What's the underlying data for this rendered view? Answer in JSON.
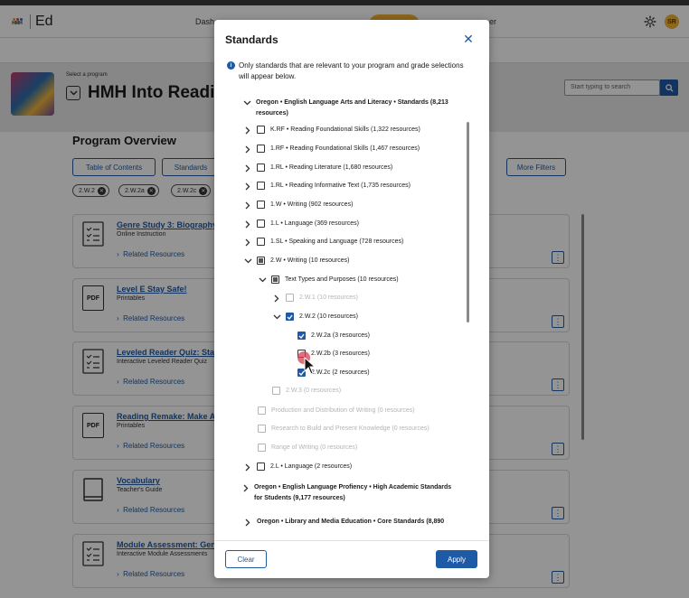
{
  "app": {
    "logo_mark": "HMH",
    "logo_text": "Ed",
    "nav_left": "Dash",
    "nav_right": "er",
    "avatar_initials": "SR",
    "colors": {
      "brand": "#1f5aa6",
      "accent": "#f2b133"
    }
  },
  "program": {
    "label": "Select a program",
    "title": "HMH Into Reading",
    "search_placeholder": "Start typing to search"
  },
  "overview": {
    "title": "Program Overview",
    "buttons": [
      "Table of Contents",
      "Standards",
      "More Filters"
    ],
    "chips": [
      "2.W.2",
      "2.W.2a",
      "2.W.2c"
    ]
  },
  "cards": [
    {
      "title": "Genre Study 3: Biography",
      "subtitle": "Online Instruction",
      "related": "Related Resources",
      "icon": "checklist-icon"
    },
    {
      "title": "Level E Stay Safe!",
      "subtitle": "Printables",
      "related": "Related Resources",
      "icon": "pdf-icon",
      "icon_text": "PDF"
    },
    {
      "title": "Leveled Reader Quiz: Sta",
      "subtitle": "Interactive Leveled Reader Quiz",
      "related": "Related Resources",
      "icon": "checklist-icon"
    },
    {
      "title": "Reading Remake: Make A",
      "subtitle": "Printables",
      "related": "Related Resources",
      "icon": "pdf-icon",
      "icon_text": "PDF"
    },
    {
      "title": "Vocabulary",
      "subtitle": "Teacher's Guide",
      "related": "Related Resources",
      "icon": "book-icon"
    },
    {
      "title": "Module Assessment: Genr",
      "subtitle": "Interactive Module Assessments",
      "related": "Related Resources",
      "icon": "checklist-icon"
    }
  ],
  "modal": {
    "title": "Standards",
    "info": "Only standards that are relevant to your program and grade selections will appear below.",
    "tree": [
      {
        "label": "Oregon • English Language Arts and Literacy • Standards (8,213 resources)",
        "depth": 0,
        "expander": "down",
        "checkbox": "none",
        "bold": true,
        "muted": false
      },
      {
        "label": "K.RF • Reading Foundational Skills (1,322 resources)",
        "depth": 1,
        "expander": "right",
        "checkbox": "empty",
        "bold": false,
        "muted": false
      },
      {
        "label": "1.RF • Reading Foundational Skills (1,467 resources)",
        "depth": 1,
        "expander": "right",
        "checkbox": "empty",
        "bold": false,
        "muted": false
      },
      {
        "label": "1.RL • Reading Literature (1,680 resources)",
        "depth": 1,
        "expander": "right",
        "checkbox": "empty",
        "bold": false,
        "muted": false
      },
      {
        "label": "1.RL • Reading Informative Text (1,735 resources)",
        "depth": 1,
        "expander": "right",
        "checkbox": "empty",
        "bold": false,
        "muted": false
      },
      {
        "label": "1.W • Writing (902 resources)",
        "depth": 1,
        "expander": "right",
        "checkbox": "empty",
        "bold": false,
        "muted": false
      },
      {
        "label": "1.L • Language (369 resources)",
        "depth": 1,
        "expander": "right",
        "checkbox": "empty",
        "bold": false,
        "muted": false
      },
      {
        "label": "1.SL • Speaking and Language (728 resources)",
        "depth": 1,
        "expander": "right",
        "checkbox": "empty",
        "bold": false,
        "muted": false
      },
      {
        "label": "2.W • Writing (10 resources)",
        "depth": 1,
        "expander": "down",
        "checkbox": "indeterminate",
        "bold": false,
        "muted": false
      },
      {
        "label": "Text Types and Purposes (10 resources)",
        "depth": 2,
        "expander": "down",
        "checkbox": "indeterminate",
        "bold": false,
        "muted": false
      },
      {
        "label": "2.W.1 (10 resources)",
        "depth": 3,
        "expander": "right",
        "checkbox": "empty",
        "bold": false,
        "muted": true
      },
      {
        "label": "2.W.2 (10 resources)",
        "depth": 3,
        "expander": "down",
        "checkbox": "checked",
        "bold": false,
        "muted": false
      },
      {
        "label": "2.W.2a (3 resources)",
        "depth": 4,
        "expander": "none",
        "checkbox": "checked",
        "bold": false,
        "muted": false
      },
      {
        "label": "2.W.2b (3 resources)",
        "depth": 4,
        "expander": "none",
        "checkbox": "empty",
        "bold": false,
        "muted": false
      },
      {
        "label": "2.W.2c (2 resources)",
        "depth": 4,
        "expander": "none",
        "checkbox": "checked",
        "bold": false,
        "muted": false
      },
      {
        "label": "2.W.3 (0 resources)",
        "depth": 3,
        "expander": "none",
        "checkbox": "empty",
        "bold": false,
        "muted": true
      },
      {
        "label": "Production and Distribution of Writing (0 resources)",
        "depth": 2,
        "expander": "none",
        "checkbox": "empty",
        "bold": false,
        "muted": true
      },
      {
        "label": "Research to Build and Present Knowledge (0 resources)",
        "depth": 2,
        "expander": "none",
        "checkbox": "empty",
        "bold": false,
        "muted": true
      },
      {
        "label": "Range of Writing (0 resources)",
        "depth": 2,
        "expander": "none",
        "checkbox": "empty",
        "bold": false,
        "muted": true
      },
      {
        "label": "2.L • Language (2 resources)",
        "depth": 1,
        "expander": "right",
        "checkbox": "empty",
        "bold": false,
        "muted": false
      },
      {
        "label": "Oregon • English Language Profiency • High Academic Standards for Students (9,177 resources)",
        "depth": 0,
        "expander": "right",
        "checkbox": "none",
        "bold": true,
        "muted": false
      },
      {
        "label": "Oregon • Library and Media Education • Core Standards (8,890",
        "depth": 0,
        "expander": "right",
        "checkbox": "none",
        "bold": true,
        "muted": false
      }
    ],
    "clear_label": "Clear",
    "apply_label": "Apply"
  }
}
